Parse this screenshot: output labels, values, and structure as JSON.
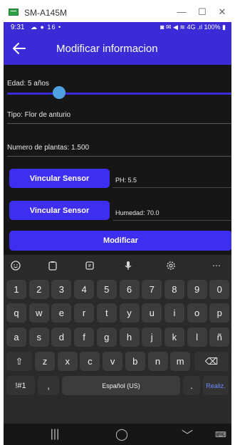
{
  "window": {
    "title": "SM-A145M",
    "minimize_glyph": "—",
    "maximize_glyph": "☐",
    "close_glyph": "✕"
  },
  "status_bar": {
    "time": "9:31",
    "left_icons": "☁ ● 16 •",
    "right_icons": "◙ ✉ ◀ ≋ 4G .ıl",
    "battery": "100%"
  },
  "app_bar": {
    "back_icon": "arrow-left-icon",
    "title": "Modificar informacion",
    "color": "#3a2bd6"
  },
  "form": {
    "age_label": "Edad: 5 años",
    "age_slider_fraction": 0.23,
    "type_label": "Tipo: Flor de anturio",
    "plants_label": "Numero de plantas: 1.500",
    "sensor_ph": {
      "button_label": "Vincular Sensor",
      "value_label": "PH: 5.5"
    },
    "sensor_humidity": {
      "button_label": "Vincular Sensor",
      "value_label": "Humedad: 70.0"
    },
    "submit_label": "Modificar",
    "button_color": "#3d2ef0"
  },
  "keyboard": {
    "toolbar": [
      "emoji-icon",
      "clipboard-icon",
      "sticker-icon",
      "microphone-icon",
      "settings-icon",
      "more-icon"
    ],
    "row_numbers": [
      "1",
      "2",
      "3",
      "4",
      "5",
      "6",
      "7",
      "8",
      "9",
      "0"
    ],
    "row_1": [
      "q",
      "w",
      "e",
      "r",
      "t",
      "y",
      "u",
      "i",
      "o",
      "p"
    ],
    "row_2": [
      "a",
      "s",
      "d",
      "f",
      "g",
      "h",
      "j",
      "k",
      "l",
      "ñ"
    ],
    "row_3": [
      "z",
      "x",
      "c",
      "v",
      "b",
      "n",
      "m"
    ],
    "shift_glyph": "⇧",
    "backspace_glyph": "⌫",
    "symbols_label": "!#1",
    "comma": ",",
    "space_label": "Español (US)",
    "period": ".",
    "action_label": "Realiz."
  },
  "nav_bar": {
    "recents_glyph": "|||",
    "home_glyph": "◯",
    "back_glyph": "﹀",
    "keyboard_glyph": "⌨"
  }
}
